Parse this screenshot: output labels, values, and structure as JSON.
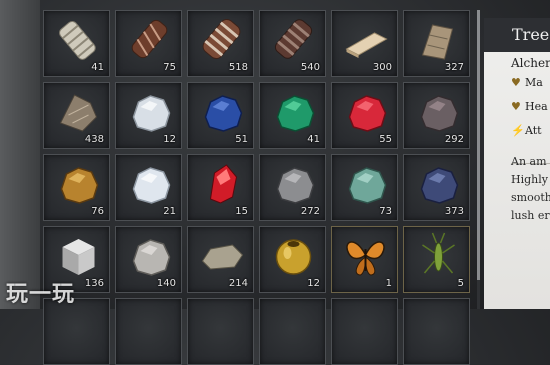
{
  "inventory": {
    "items": [
      {
        "icon": "bandage-bundle-icon",
        "qty": "41"
      },
      {
        "icon": "rope-wrapped-log-icon",
        "qty": "75"
      },
      {
        "icon": "cloth-bound-bundle-icon",
        "qty": "518"
      },
      {
        "icon": "leather-strap-bundle-icon",
        "qty": "540"
      },
      {
        "icon": "wooden-plank-icon",
        "qty": "300"
      },
      {
        "icon": "weathered-board-icon",
        "qty": "327"
      },
      {
        "icon": "splintered-wood-icon",
        "qty": "438"
      },
      {
        "icon": "clear-crystal-icon",
        "qty": "12"
      },
      {
        "icon": "sapphire-ore-icon",
        "qty": "51"
      },
      {
        "icon": "emerald-ore-icon",
        "qty": "41"
      },
      {
        "icon": "ruby-chunk-icon",
        "qty": "55"
      },
      {
        "icon": "layered-stone-icon",
        "qty": "292"
      },
      {
        "icon": "gold-ore-icon",
        "qty": "76"
      },
      {
        "icon": "white-quartz-icon",
        "qty": "21"
      },
      {
        "icon": "red-crystal-icon",
        "qty": "15"
      },
      {
        "icon": "iron-ore-icon",
        "qty": "272"
      },
      {
        "icon": "jade-ore-icon",
        "qty": "73"
      },
      {
        "icon": "dark-blue-ore-icon",
        "qty": "373"
      },
      {
        "icon": "stone-cube-icon",
        "qty": "136"
      },
      {
        "icon": "rough-stone-icon",
        "qty": "140"
      },
      {
        "icon": "flat-stone-icon",
        "qty": "214"
      },
      {
        "icon": "golden-orb-icon",
        "qty": "12"
      },
      {
        "icon": "butterfly-icon",
        "qty": "1"
      },
      {
        "icon": "grasshopper-icon",
        "qty": "5"
      }
    ]
  },
  "detail_panel": {
    "title": "Tree",
    "subtitle": "Alcher",
    "stats": [
      {
        "icon": "heart-icon",
        "label": "Ma"
      },
      {
        "icon": "heart-icon",
        "label": "Hea"
      },
      {
        "icon": "stamina-icon",
        "label": "Att"
      }
    ],
    "description_lines": [
      "An am",
      "Highly",
      "smooth",
      "lush er"
    ]
  },
  "watermark": "玩一玩"
}
